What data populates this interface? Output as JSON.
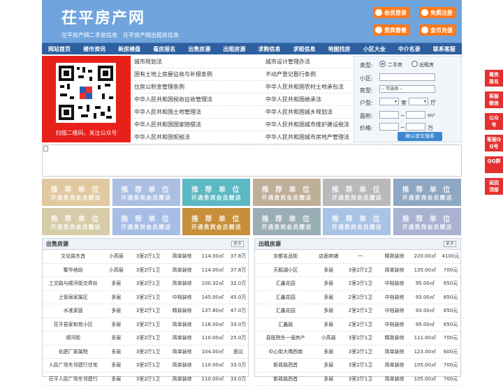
{
  "header": {
    "title": "茌平房产网",
    "subtitle": "茌平房产网二手房信息　茌平房产网出租房信息",
    "buttons": [
      "会员登录",
      "免费注册",
      "贵宾套餐",
      "金币充值"
    ]
  },
  "nav": [
    "网站首页",
    "楼市资讯",
    "新房楼盘",
    "看房报名",
    "出售房源",
    "出租房源",
    "求购信息",
    "求租信息",
    "地图找房",
    "小区大全",
    "中介名录",
    "联系客服"
  ],
  "qr_caption": "扫描二维码，关注公众号",
  "links": [
    [
      "城市规划法",
      "城市设计管理办法"
    ],
    [
      "国有土地上房屋征收与补偿条例",
      "不动产登记暂行条例"
    ],
    [
      "住房公积金管理条例",
      "中华人民共和国农村土地承包法"
    ],
    [
      "中华人民共和国税收征收管理法",
      "中华人民共和国继承法"
    ],
    [
      "中华人民共和国土地管理法",
      "中华人民共和国城乡规划法"
    ],
    [
      "中华人民共和国国家赔偿法",
      "中华人民共和国城市维护建设税法"
    ],
    [
      "中华人民共和国契税法",
      "中华人民共和国城市房地产管理法"
    ]
  ],
  "search": {
    "type_label": "类型:",
    "type_options": [
      "二手房",
      "出租房"
    ],
    "community_label": "小区:",
    "housetype_label": "房型:",
    "housetype_value": "-- 可选择 --",
    "layout_label": "户型:",
    "room_unit": "室",
    "hall_unit": "厅",
    "area_label": "面积:",
    "area_unit": "m²",
    "price_label": "价格:",
    "price_unit": "万",
    "range_sep": "~",
    "submit": "确认提交搜索"
  },
  "ads": {
    "line1": "推 荐 单 位",
    "line2": "开通贵宾会员赠送",
    "colors": [
      "#e0c9a0",
      "#aabfe2",
      "#5cb8c2",
      "#bfae98",
      "#b9b9b9",
      "#8ea7c2",
      "#d6cca8",
      "#a7bde6",
      "#c78f3a",
      "#9aaeb6",
      "#a9c3e6",
      "#aab2d2"
    ]
  },
  "sale": {
    "title": "出售房源",
    "more": "更多",
    "rows": [
      [
        "文化路东首",
        "小高层",
        "3室2厅1卫",
        "简单装修",
        "114.00㎡",
        "37.8万"
      ],
      [
        "繁华地段",
        "小高层",
        "3室2厅1卫",
        "简单装修",
        "114.00㎡",
        "37.8万"
      ],
      [
        "工交路与顺河街交界处",
        "多层",
        "3室2厅1卫",
        "简单装修",
        "100.32㎡",
        "32.0万"
      ],
      [
        "土管局家属区",
        "多层",
        "3室2厅1卫",
        "中档装修",
        "145.00㎡",
        "45.0万"
      ],
      [
        "水准家庭",
        "多层",
        "3室2厅1卫",
        "精装装修",
        "137.80㎡",
        "47.0万"
      ],
      [
        "茌平县家和苑小区",
        "多层",
        "3室2厅1卫",
        "简单装修",
        "116.00㎡",
        "33.0万"
      ],
      [
        "顺河街",
        "多层",
        "3室2厅1卫",
        "简单装修",
        "110.00㎡",
        "25.0万"
      ],
      [
        "化肥厂家属院",
        "多层",
        "3室2厅1卫",
        "简单装修",
        "104.00㎡",
        "面议"
      ],
      [
        "人民广场东邻建行住宅",
        "多层",
        "3室2厅1卫",
        "简单装修",
        "110.00㎡",
        "33.0万"
      ],
      [
        "茌平人民广场东邻建行",
        "多层",
        "3室2厅1卫",
        "简单装修",
        "110.00㎡",
        "33.0万"
      ]
    ]
  },
  "rent": {
    "title": "出租房源",
    "more": "更多",
    "rows": [
      [
        "京都名品街",
        "店面商铺",
        "一",
        "精致装修",
        "220.00㎡",
        "4100元"
      ],
      [
        "天鹅湖小区",
        "多层",
        "3室2厅2卫",
        "简单装修",
        "135.00㎡",
        "700元"
      ],
      [
        "汇鑫花园",
        "多层",
        "2室2厅1卫",
        "中档装修",
        "95.00㎡",
        "650元"
      ],
      [
        "汇鑫花园",
        "多层",
        "2室2厅1卫",
        "中档装修",
        "93.00㎡",
        "650元"
      ],
      [
        "汇鑫花园",
        "多层",
        "2室2厅1卫",
        "中档装修",
        "93.00㎡",
        "650元"
      ],
      [
        "汇鑫路",
        "多层",
        "2室2厅1卫",
        "中档装修",
        "95.00㎡",
        "650元"
      ],
      [
        "县医院东一诺房产",
        "小高层",
        "3室2厅1卫",
        "精致装修",
        "111.00㎡",
        "700元"
      ],
      [
        "中心街大隅西南",
        "多层",
        "3室2厅1卫",
        "简单装修",
        "123.00㎡",
        "600元"
      ],
      [
        "新政路西首",
        "多层",
        "3室2厅1卫",
        "简单装修",
        "105.00㎡",
        "700元"
      ],
      [
        "新政路西首",
        "多层",
        "3室2厅1卫",
        "简单装修",
        "105.00㎡",
        "700元"
      ]
    ]
  },
  "side": [
    "看房报名",
    "客服微信",
    "公众号",
    "客服QQ号",
    "QQ群",
    "返回顶部"
  ]
}
